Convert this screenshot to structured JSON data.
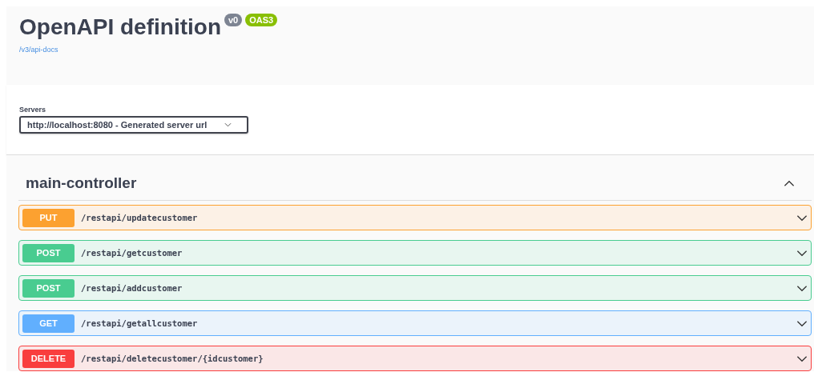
{
  "info": {
    "title": "OpenAPI definition",
    "version": "v0",
    "spec_badge": "OAS3",
    "docs_link": "/v3/api-docs"
  },
  "servers": {
    "label": "Servers",
    "value": "http://localhost:8080 - Generated server url"
  },
  "tag": {
    "name": "main-controller",
    "expanded": true,
    "operations": [
      {
        "method": "PUT",
        "kind": "put",
        "path": "/restapi/updatecustomer",
        "expanded": false
      },
      {
        "method": "POST",
        "kind": "post",
        "path": "/restapi/getcustomer",
        "expanded": false
      },
      {
        "method": "POST",
        "kind": "post",
        "path": "/restapi/addcustomer",
        "expanded": false
      },
      {
        "method": "GET",
        "kind": "get",
        "path": "/restapi/getallcustomer",
        "expanded": false
      },
      {
        "method": "DELETE",
        "kind": "delete",
        "path": "/restapi/deletecustomer/{idcustomer}",
        "expanded": false
      }
    ]
  }
}
